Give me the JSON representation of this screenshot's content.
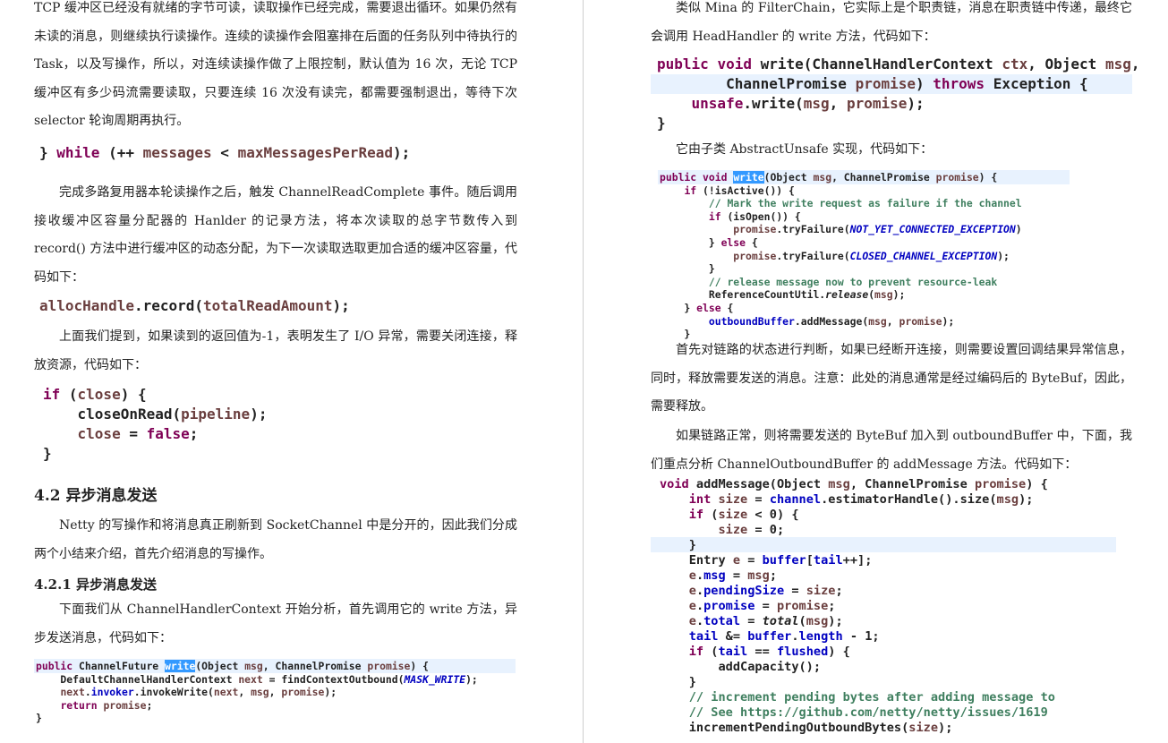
{
  "left": {
    "p1": "TCP 缓冲区已经没有就绪的字节可读，读取操作已经完成，需要退出循环。如果仍然有未读的消息，则继续执行读操作。连续的读操作会阻塞排在后面的任务队列中待执行的 Task，以及写操作，所以，对连续读操作做了上限控制，默认值为 16 次，无论 TCP 缓冲区有多少码流需要读取，只要连续 16 次没有读完，都需要强制退出，等待下次 selector 轮询周期再执行。",
    "p2": "完成多路复用器本轮读操作之后，触发 ChannelReadComplete 事件。随后调用接收缓冲区容量分配器的 Hanlder 的记录方法，将本次读取的总字节数传入到 record() 方法中进行缓冲区的动态分配，为下一次读取选取更加合适的缓冲区容量，代码如下：",
    "p3": "上面我们提到，如果读到的返回值为-1，表明发生了 I/O 异常，需要关闭连接，释放资源，代码如下：",
    "h2": "4.2 异步消息发送",
    "p4": "Netty 的写操作和将消息真正刷新到 SocketChannel 中是分开的，因此我们分成两个小结来介绍，首先介绍消息的写操作。",
    "h3": "4.2.1 异步消息发送",
    "p5": "下面我们从 ChannelHandlerContext 开始分析，首先调用它的 write 方法，异步发送消息，代码如下："
  },
  "right": {
    "p1": "类似 Mina 的 FilterChain，它实际上是个职责链，消息在职责链中传递，最终它会调用 HeadHandler 的 write 方法，代码如下：",
    "p2": "它由子类 AbstractUnsafe 实现，代码如下：",
    "p3": "首先对链路的状态进行判断，如果已经断开连接，则需要设置回调结果异常信息，同时，释放需要发送的消息。注意：此处的消息通常是经过编码后的 ByteBuf，因此，需要释放。",
    "p4": "如果链路正常，则将需要发送的 ByteBuf 加入到 outboundBuffer 中，下面，我们重点分析 ChannelOutboundBuffer 的 addMessage 方法。代码如下："
  }
}
